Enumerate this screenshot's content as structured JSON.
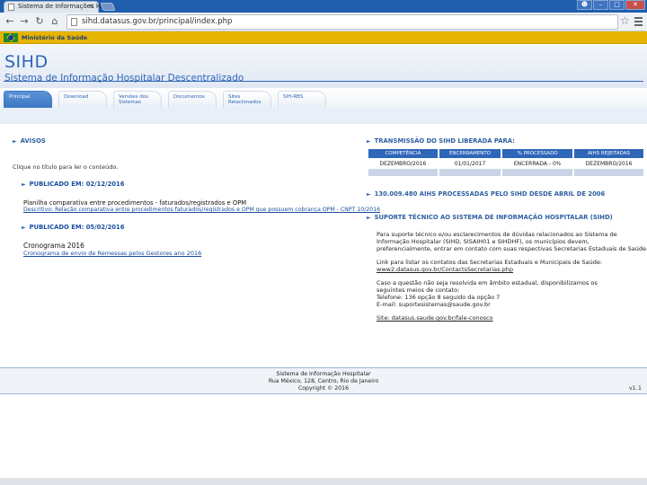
{
  "browser": {
    "tab_title": "Sistema de Informações Hos",
    "tab_close": "×",
    "url": "sihd.datasus.gov.br/principal/index.php"
  },
  "gov_bar": {
    "label": "Ministério da Saúde"
  },
  "header": {
    "title": "SIHD",
    "subtitle": "Sistema de Informação Hospitalar Descentralizado"
  },
  "nav": {
    "tabs": [
      {
        "label": "Principal"
      },
      {
        "label": "Download"
      },
      {
        "label": "Versões dos Sistemas"
      },
      {
        "label": "Documentos"
      },
      {
        "label": "Sites Relacionados"
      },
      {
        "label": "SIH-RBS"
      }
    ]
  },
  "avisos": {
    "heading": "AVISOS",
    "intro": "Clique no título para ler o conteúdo.",
    "item1_date": "PUBLICADO EM: 02/12/2016",
    "item1_title": "Planilha comparativa entre procedimentos - faturados/registrados e OPM",
    "item1_link": "Descritivo: Relação comparativa entre procedimentos faturados/registrados e OPM que possuem cobrança OPM - CNPT 10/2016",
    "item2_date": "PUBLICADO EM: 05/02/2016",
    "item2_title": "Cronograma 2016",
    "item2_link": "Cronograma de envio de Remessas pelos Gestores ano 2016"
  },
  "transmissao": {
    "heading": "TRANSMISSÃO DO SIHD LIBERADA PARA:",
    "columns": [
      "COMPETÊNCIA",
      "ENCERRAMENTO",
      "% PROCESSADO",
      "AIHS REJEITADAS"
    ],
    "row": [
      "DEZEMBRO/2016",
      "01/01/2017",
      "ENCERRADA - 0%",
      "DEZEMBRO/2016"
    ]
  },
  "aihs": {
    "heading": "130.009.480 AIHS PROCESSADAS PELO SIHD DESDE ABRIL DE 2006"
  },
  "suporte": {
    "heading": "SUPORTE TÉCNICO AO SISTEMA DE INFORMAÇÃO HOSPITALAR (SIHD)",
    "lines": [
      "Para suporte técnico e/ou esclarecimentos de dúvidas relacionados ao Sistema de",
      "Informação Hospitalar (SIHD, SISAIH01 e SIHDHF), os municípios devem,",
      "preferencialmente, entrar em contato com suas respectivas Secretarias Estaduais de Saúde.",
      "Link para listar os contatos das Secretarias Estaduais e Municipais de Saúde:",
      "Caso a questão não seja resolvida em âmbito estadual, disponibilizamos os",
      "seguintes meios de contato:",
      "Telefone: 136 opção 8 seguido da opção 7",
      "E-mail: suportesistemas@saude.gov.br"
    ],
    "contacts_link": "www2.datasus.gov.br/ContactsSecretarias.php",
    "site_link": "Site: datasus.saude.gov.br/fale-conosco"
  },
  "footer": {
    "line1": "Sistema de Informação Hospitalar",
    "line2": "Rua México, 128, Centro, Rio de Janeiro",
    "line3": "Copyright © 2016",
    "code": "v1.1"
  }
}
